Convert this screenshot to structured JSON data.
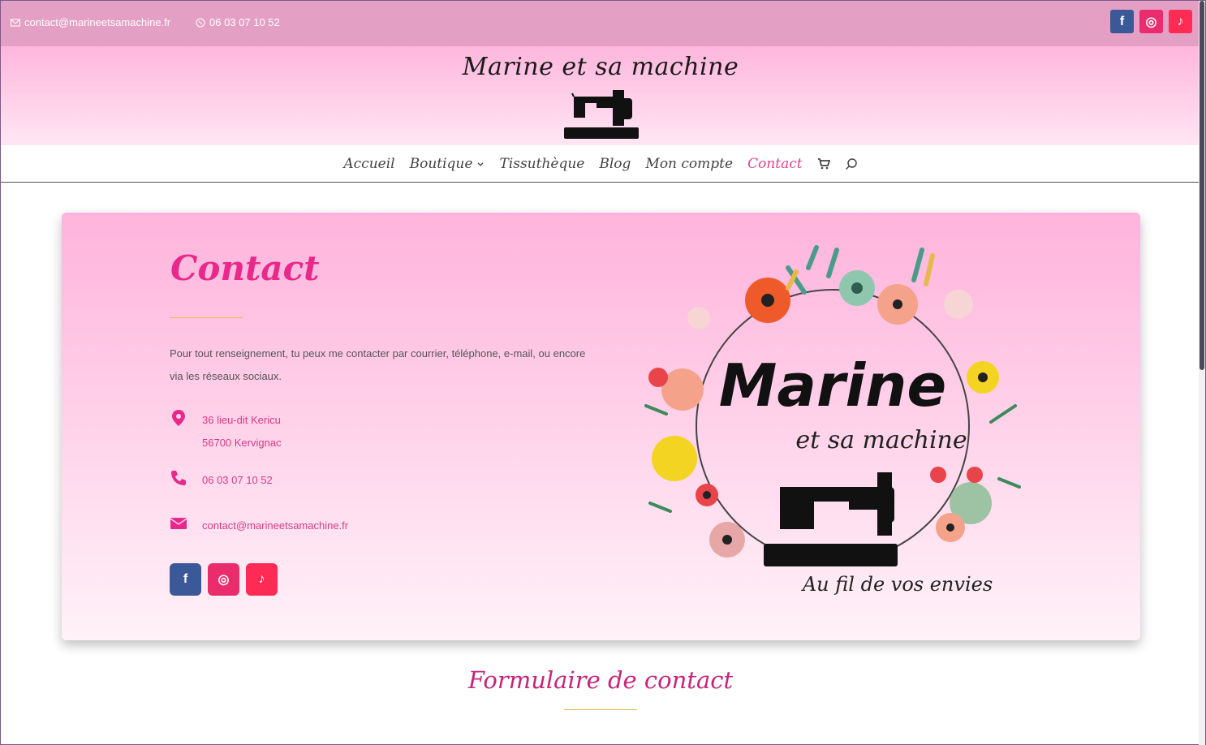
{
  "topbar": {
    "email": "contact@marineetsamachine.fr",
    "phone": "06 03 07 10 52",
    "social": [
      {
        "name": "facebook",
        "glyph": "f",
        "color": "#3b5998"
      },
      {
        "name": "instagram",
        "glyph": "◎",
        "color": "#ea2c6d"
      },
      {
        "name": "tiktok",
        "glyph": "♪",
        "color": "#fe2c55"
      }
    ]
  },
  "header": {
    "brand": "Marine et sa machine"
  },
  "nav": {
    "items": [
      "Accueil",
      "Boutique",
      "Tissuthèque",
      "Blog",
      "Mon compte",
      "Contact"
    ],
    "active": "Contact"
  },
  "card": {
    "title": "Contact",
    "description": "Pour tout renseignement, tu peux me contacter par courrier, téléphone, e-mail, ou encore via les réseaux sociaux.",
    "address_line1": "36 lieu-dit Kericu",
    "address_line2": "56700 Kervignac",
    "phone": "06 03 07 10 52",
    "email": "contact@marineetsamachine.fr",
    "logo_title": "Marine",
    "logo_subtitle": "et sa machine",
    "logo_tagline": "Au fil de vos envies"
  },
  "form": {
    "title": "Formulaire de contact"
  },
  "colors": {
    "accent": "#e8288a",
    "topbar": "#e4a0c4",
    "divider": "#e5b94a"
  }
}
